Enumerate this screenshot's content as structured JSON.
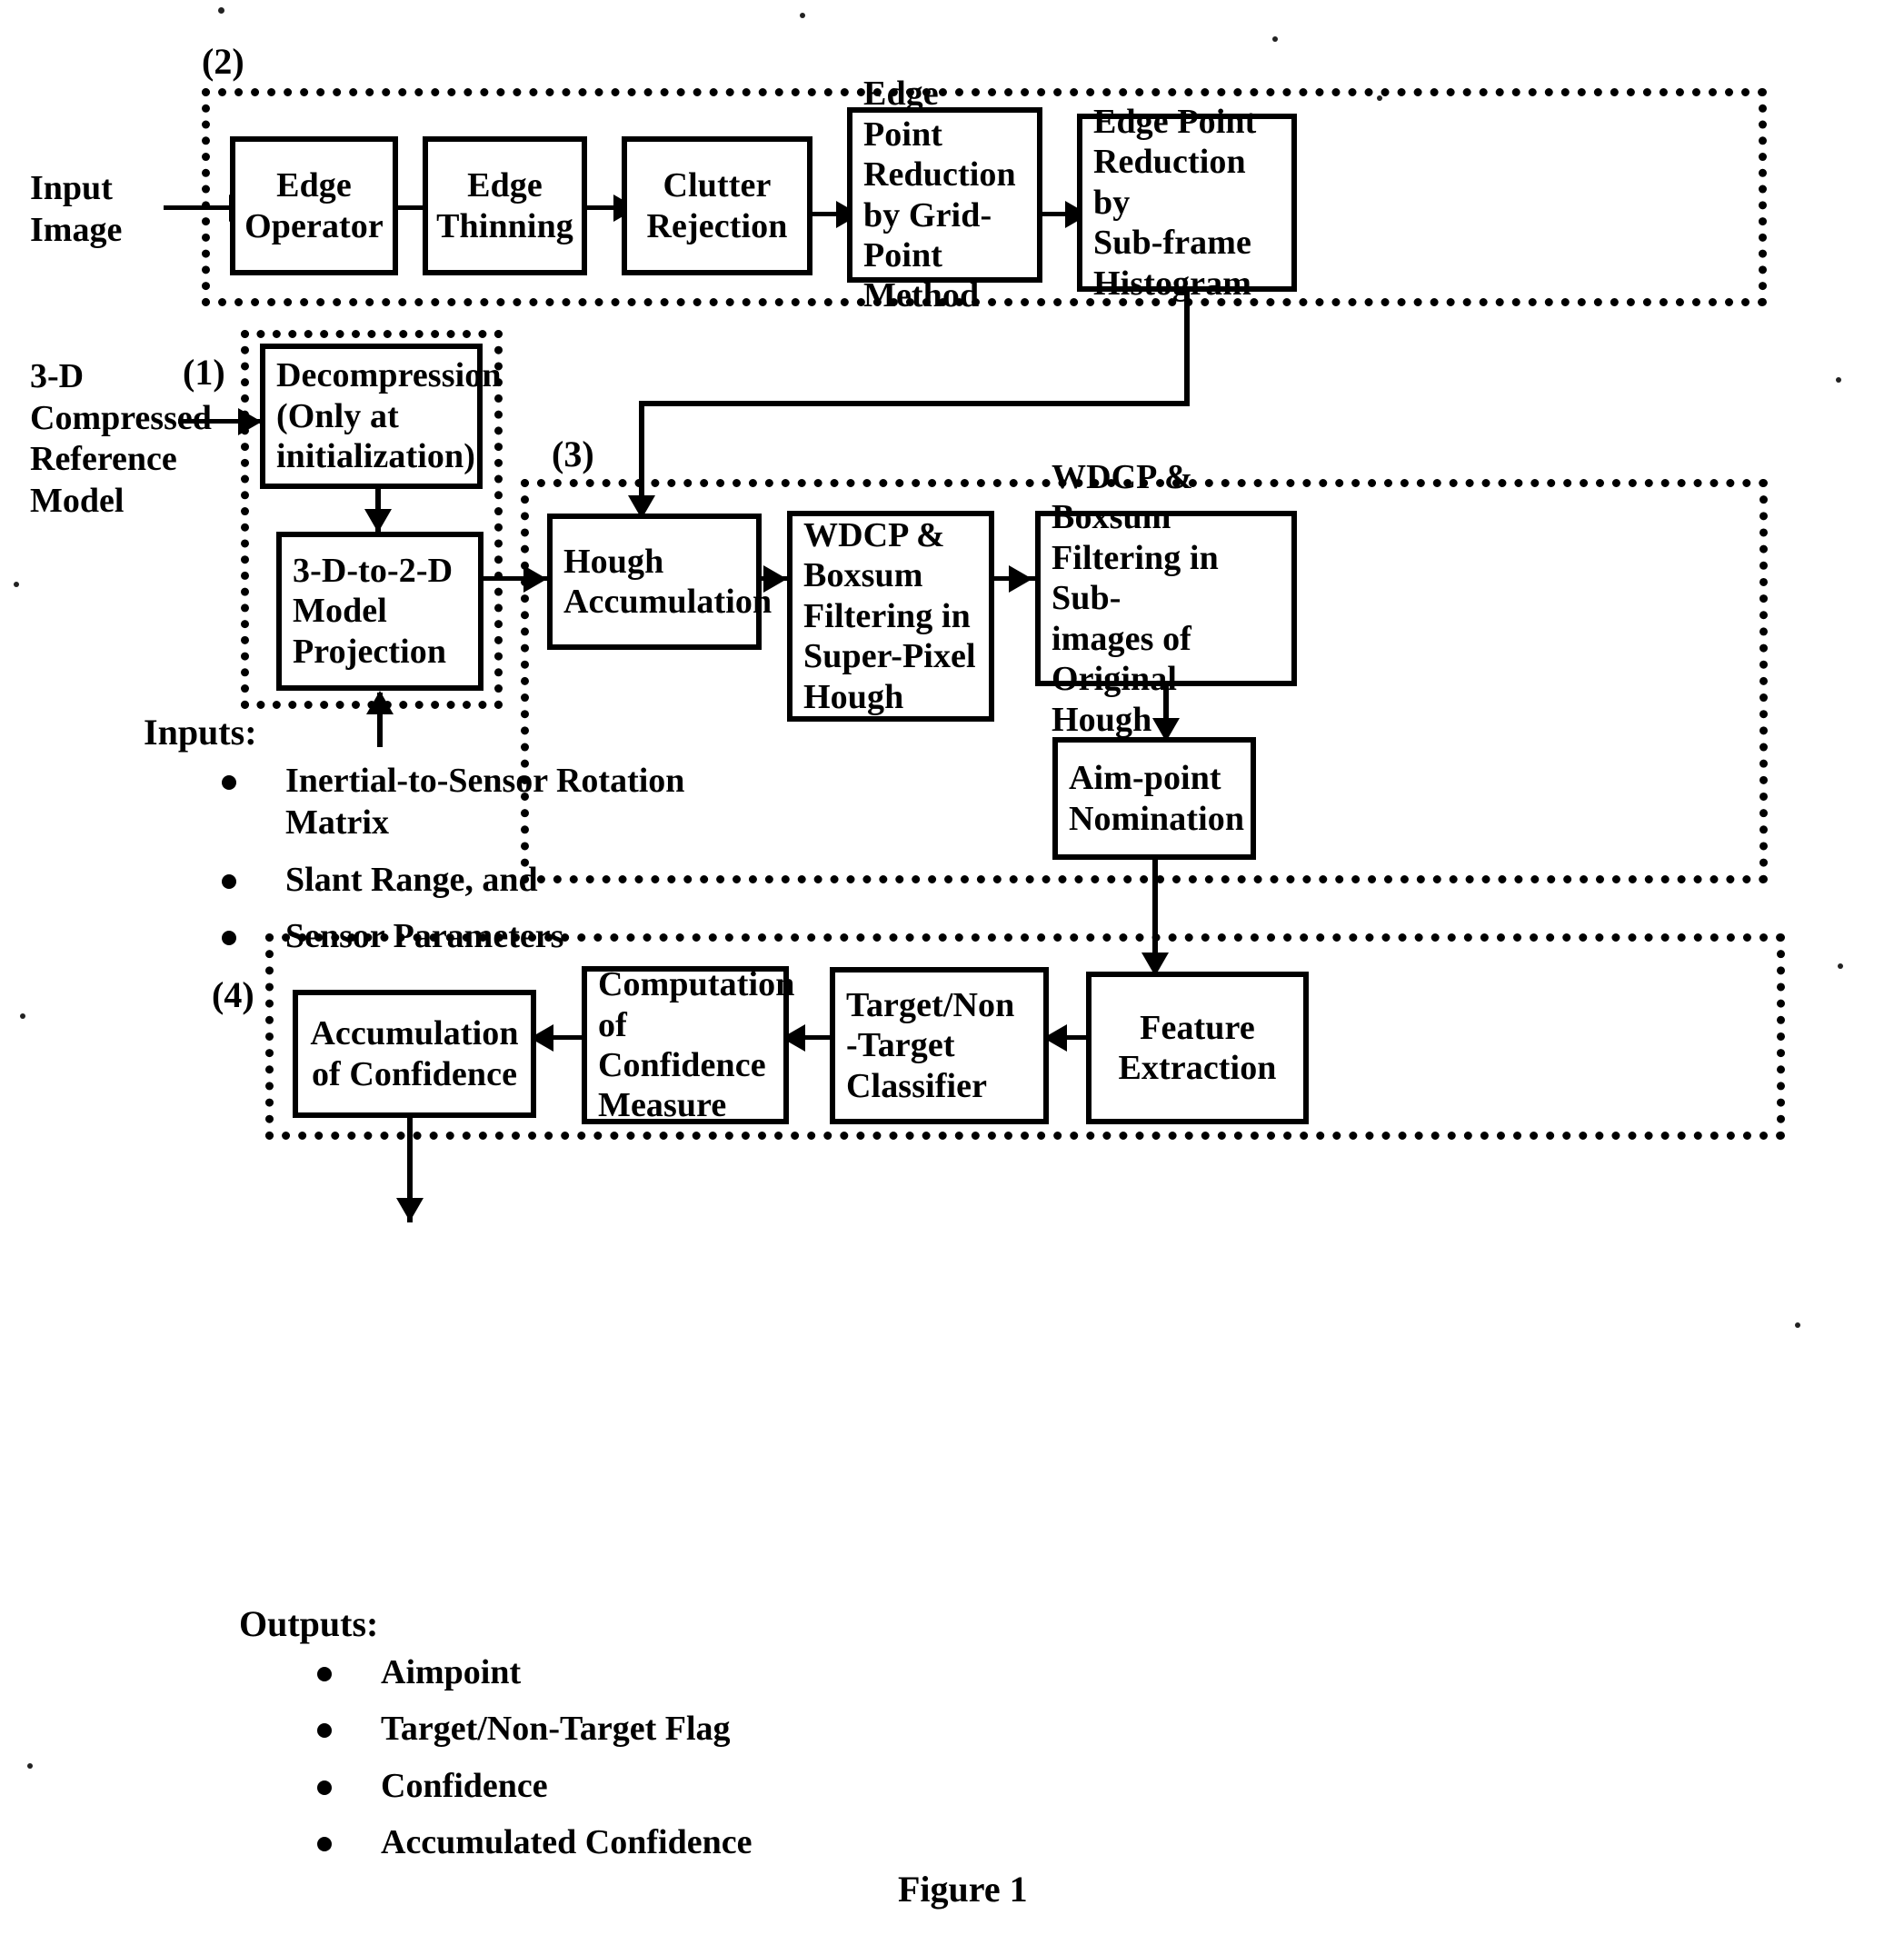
{
  "figure": {
    "caption": "Figure 1"
  },
  "group_tags": {
    "stage1": "(1)",
    "stage2": "(2)",
    "stage3": "(3)",
    "stage4": "(4)"
  },
  "external_labels": {
    "input_image": "Input\nImage",
    "reference_model": "3-D\nCompressed\nReference\nModel"
  },
  "stage2": {
    "boxes": [
      {
        "id": "edge-operator",
        "label": "Edge\nOperator"
      },
      {
        "id": "edge-thinning",
        "label": "Edge\nThinning"
      },
      {
        "id": "clutter-rejection",
        "label": "Clutter\nRejection"
      },
      {
        "id": "edge-point-reduction-grid",
        "label": "Edge Point\nReduction\nby Grid-\nPoint\nMethod"
      },
      {
        "id": "edge-point-reduction-subframe",
        "label": "Edge Point\nReduction by\nSub-frame\nHistogram"
      }
    ]
  },
  "stage1": {
    "boxes": [
      {
        "id": "decompression",
        "label": "Decompression\n(Only at\ninitialization)"
      },
      {
        "id": "model-projection",
        "label": "3-D-to-2-D\nModel\nProjection"
      }
    ]
  },
  "stage3": {
    "boxes": [
      {
        "id": "hough-accumulation",
        "label": "Hough\nAccumulation"
      },
      {
        "id": "wdcp-superpixel",
        "label": "WDCP &\nBoxsum\nFiltering in\nSuper-Pixel\nHough"
      },
      {
        "id": "wdcp-subimages",
        "label": "WDCP & Boxsum\nFiltering in Sub-\nimages of Original\nHough"
      },
      {
        "id": "aim-point-nomination",
        "label": "Aim-point\nNomination"
      }
    ]
  },
  "stage4": {
    "boxes": [
      {
        "id": "accumulation-of-confidence",
        "label": "Accumulation\nof Confidence"
      },
      {
        "id": "computation-of-confidence-measure",
        "label": "Computation\nof\nConfidence\nMeasure"
      },
      {
        "id": "target-nontarget-classifier",
        "label": "Target/Non\n-Target\nClassifier"
      },
      {
        "id": "feature-extraction",
        "label": "Feature\nExtraction"
      }
    ]
  },
  "inputs": {
    "title": "Inputs:",
    "items": [
      "Inertial-to-Sensor Rotation Matrix",
      "Slant Range, and",
      "Sensor Parameters"
    ]
  },
  "outputs": {
    "title": "Outputs:",
    "items": [
      "Aimpoint",
      "Target/Non-Target Flag",
      "Confidence",
      "Accumulated Confidence"
    ]
  },
  "colors": {
    "ink": "#000000",
    "paper": "#ffffff"
  }
}
